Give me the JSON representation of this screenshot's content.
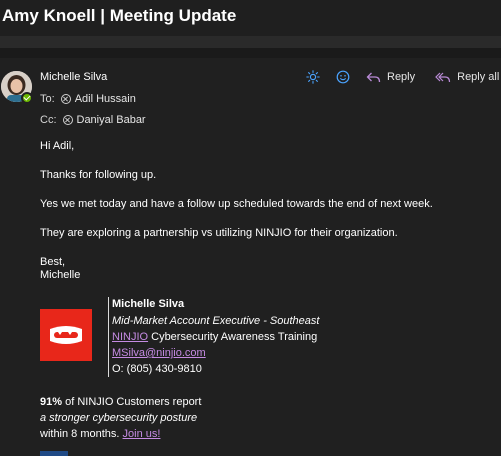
{
  "subject": "Amy Knoell | Meeting Update",
  "sender": {
    "name": "Michelle Silva"
  },
  "recipients": {
    "to_label": "To:",
    "to": [
      "Adil Hussain"
    ],
    "cc_label": "Cc:",
    "cc": [
      "Daniyal Babar"
    ]
  },
  "actions": {
    "reply_label": "Reply",
    "reply_all_label": "Reply all",
    "icons": [
      "sun-icon",
      "emoji-icon",
      "reply-icon",
      "reply-all-icon"
    ]
  },
  "body": {
    "greeting": "Hi Adil,",
    "lines": [
      "Thanks for following up.",
      "Yes we met today and have a follow up scheduled towards the end of next week.",
      "They are exploring a partnership vs utilizing NINJIO for their organization."
    ],
    "closing": "Best,",
    "closing_name": "Michelle"
  },
  "signature": {
    "name": "Michelle Silva",
    "title": "Mid-Market Account Executive - Southeast",
    "company_link": "NINJIO",
    "company_rest": " Cybersecurity Awareness Training",
    "email": "MSilva@ninjio.com",
    "phone": "O: (805) 430-9810",
    "promo_bold": "91%",
    "promo_line1_rest": " of NINJIO Customers report",
    "promo_line2": "a stronger cybersecurity posture",
    "promo_line3": "within 8 months. ",
    "promo_link": "Join us!"
  },
  "colors": {
    "background": "#202020",
    "link": "#c58be3",
    "accent_blue": "#4aa3ff",
    "logo_red": "#e8271a",
    "presence_green": "#6bb700"
  }
}
